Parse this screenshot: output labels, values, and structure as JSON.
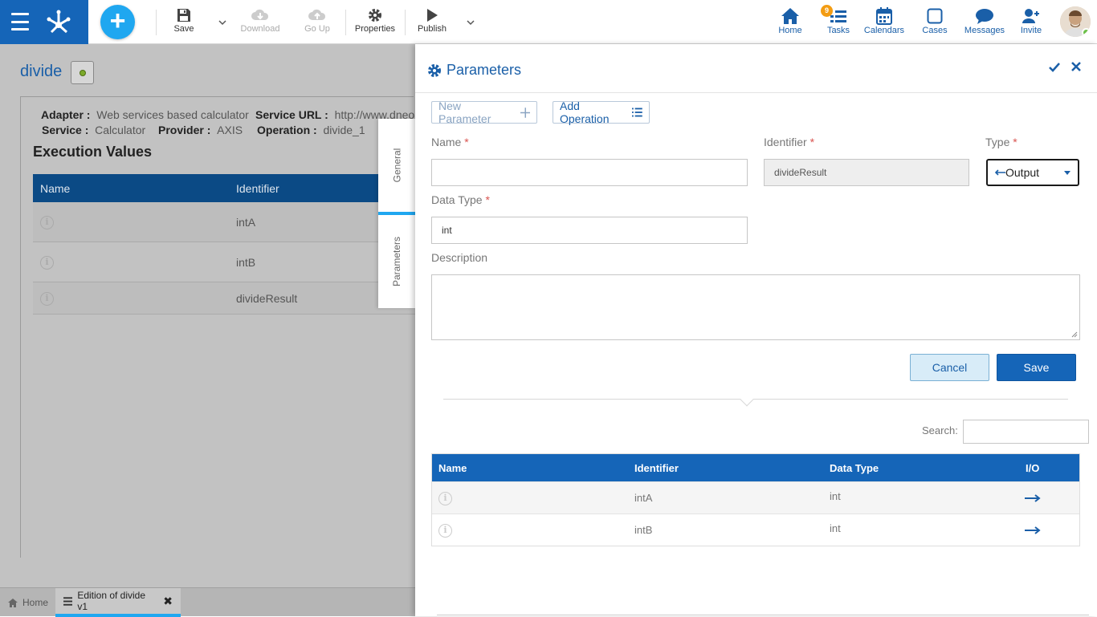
{
  "toolbar": {
    "save": "Save",
    "download": "Download",
    "go_up": "Go Up",
    "properties": "Properties",
    "publish": "Publish"
  },
  "nav": {
    "home": "Home",
    "tasks": "Tasks",
    "tasks_badge": "9",
    "calendars": "Calendars",
    "cases": "Cases",
    "messages": "Messages",
    "invite": "Invite"
  },
  "page": {
    "title": "divide",
    "adapter_label": "Adapter :",
    "adapter_value": "Web services based calculator",
    "service_url_label": "Service URL :",
    "service_url_value": "http://www.dneonli",
    "service_label": "Service :",
    "service_value": "Calculator",
    "provider_label": "Provider :",
    "provider_value": "AXIS",
    "operation_label": "Operation :",
    "operation_value": "divide_1",
    "exec_title": "Execution Values",
    "table_headers": [
      "Name",
      "Identifier"
    ],
    "rows": [
      {
        "identifier": "intA"
      },
      {
        "identifier": "intB"
      },
      {
        "identifier": "divideResult"
      }
    ]
  },
  "side_tabs": {
    "general": "General",
    "parameters": "Parameters"
  },
  "bottom_tabs": {
    "home": "Home",
    "edition": "Edition of divide v1"
  },
  "panel": {
    "title": "Parameters",
    "new_parameter": "New Parameter",
    "add_operation": "Add Operation",
    "name_label": "Name",
    "identifier_label": "Identifier",
    "type_label": "Type",
    "data_type_label": "Data Type",
    "description_label": "Description",
    "required_mark": "*",
    "name_value": "",
    "identifier_value": "divideResult",
    "type_value": "Output",
    "data_type_value": "int",
    "cancel": "Cancel",
    "save": "Save",
    "search_label": "Search:",
    "table_headers": [
      "Name",
      "Identifier",
      "Data Type",
      "I/O"
    ],
    "rows": [
      {
        "identifier": "intA",
        "data_type": "int"
      },
      {
        "identifier": "intB",
        "data_type": "int"
      }
    ]
  },
  "colors": {
    "brand": "#1565b8",
    "accent": "#1fa7f0",
    "badge": "#f39c12",
    "required": "#d9534f"
  }
}
